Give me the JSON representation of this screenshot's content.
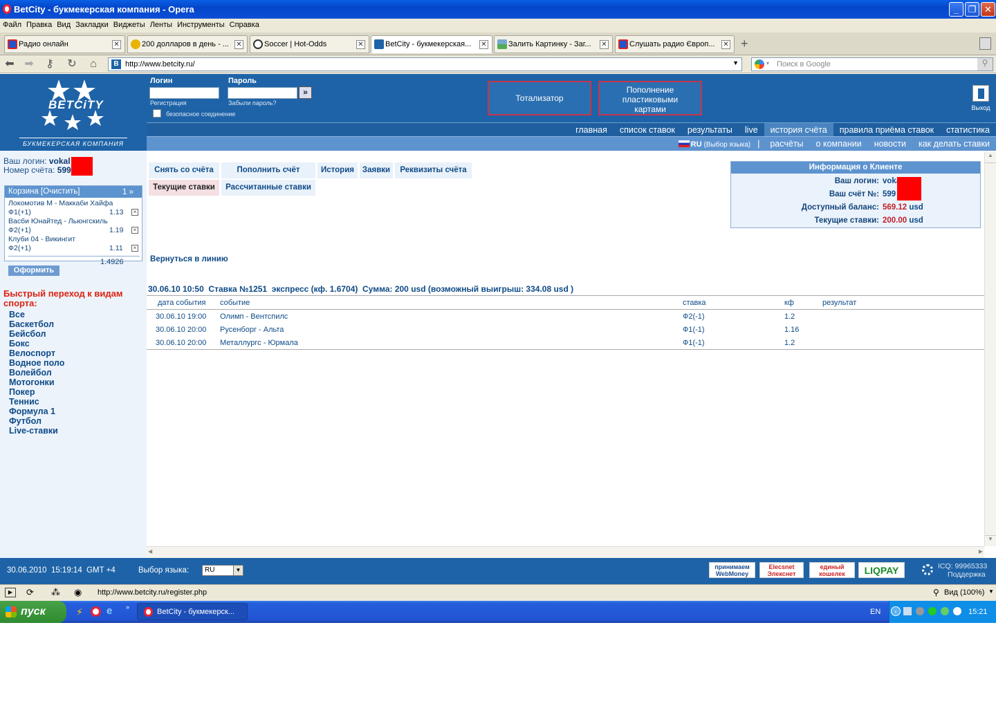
{
  "window": {
    "title": "BetCity - букмекерская компания - Opera"
  },
  "menu": [
    "Файл",
    "Правка",
    "Вид",
    "Закладки",
    "Виджеты",
    "Ленты",
    "Инструменты",
    "Справка"
  ],
  "tabs": [
    {
      "label": "Радио онлайн"
    },
    {
      "label": "200 долларов в день - ..."
    },
    {
      "label": "Soccer | Hot-Odds"
    },
    {
      "label": "BetCity - букмекерская..."
    },
    {
      "label": "Залить Картинку - Заг..."
    },
    {
      "label": "Слушать радио Європ..."
    }
  ],
  "address": {
    "url": "http://www.betcity.ru/",
    "search_placeholder": "Поиск в Google"
  },
  "site": {
    "logo_name": "BETCiTY",
    "logo_sub": "БУКМЕКЕРСКАЯ КОМПАНИЯ",
    "login_label": "Логин",
    "password_label": "Пароль",
    "go_symbol": "»",
    "register": "Регистрация",
    "forgot": "Забыли пароль?",
    "secure": "безопасное соединение",
    "btn_tote": "Тотализатор",
    "btn_topup": "Пополнение пластиковыми картами",
    "exit": "Выход",
    "nav1": [
      "главная",
      "список ставок",
      "результаты",
      "live",
      "история счёта",
      "правила приёма ставок",
      "статистика"
    ],
    "nav2_lang": "RU",
    "nav2_lang_choose": "(Выбор языка)",
    "nav2_sep": "|",
    "nav2": [
      "расчёты",
      "о компании",
      "новости",
      "как делать ставки"
    ]
  },
  "left": {
    "login_label": "Ваш логин:",
    "login_value": "vokal",
    "account_label": "Номер счёта:",
    "account_value": "599",
    "basket_title": "Корзина [Очистить]",
    "basket_count": "1 »",
    "items": [
      {
        "event": "Локомотив М - Маккаби Хайфа",
        "outcome": "Ф1(+1)",
        "coef": "1.13",
        "remove": "×"
      },
      {
        "event": "Васби Юнайтед - Льюнгскиль",
        "outcome": "Ф2(+1)",
        "coef": "1.19",
        "remove": "×"
      },
      {
        "event": "Клуби 04 - Викингит",
        "outcome": "Ф2(+1)",
        "coef": "1.11",
        "remove": "×"
      }
    ],
    "total": "1.4926",
    "order_btn": "Оформить",
    "sports_title": "Быстрый переход к видам спорта:",
    "sports": [
      "Все",
      "Баскетбол",
      "Бейсбол",
      "Бокс",
      "Велоспорт",
      "Водное поло",
      "Волейбол",
      "Мотогонки",
      "Покер",
      "Теннис",
      "Формула 1",
      "Футбол",
      "Live-ставки"
    ]
  },
  "main": {
    "subtabs_row1": [
      "Снять со счёта",
      "Пополнить счёт",
      "История",
      "Заявки",
      "Реквизиты счёта"
    ],
    "subtabs_row2": [
      "Текущие ставки",
      "Рассчитанные ставки"
    ],
    "client": {
      "title": "Информация о Клиенте",
      "login_label": "Ваш логин:",
      "login_value": "vokal",
      "account_label": "Ваш счёт №:",
      "account_value": "599",
      "balance_label": "Доступный баланс:",
      "balance_value": "569.12",
      "balance_cur": "usd",
      "current_label": "Текущие ставки:",
      "current_value": "200.00",
      "current_cur": "usd"
    },
    "back": "Вернуться в линию",
    "bet_header": "30.06.10 10:50  Ставка №1251  экспресс (кф. 1.6704)  Сумма: 200 usd (возможный выигрыш: 334.08 usd )",
    "columns": [
      "дата события",
      "событие",
      "ставка",
      "кф",
      "результат"
    ],
    "rows": [
      {
        "date": "30.06.10 19:00",
        "event": "Олимп - Вентспилс",
        "bet": "Ф2(-1)",
        "coef": "1.2",
        "result": ""
      },
      {
        "date": "30.06.10 20:00",
        "event": "Русенборг - Альта",
        "bet": "Ф1(-1)",
        "coef": "1.16",
        "result": ""
      },
      {
        "date": "30.06.10 20:00",
        "event": "Металлургс - Юрмала",
        "bet": "Ф1(-1)",
        "coef": "1.2",
        "result": ""
      }
    ]
  },
  "footer": {
    "datetime": "30.06.2010  15:19:14  GMT +4",
    "lang_label": "Выбор языка:",
    "lang_value": "RU",
    "pay": [
      "принимаем WebMoney",
      "Elecsnet Элекснет",
      "единый кошелек",
      "LIQPAY"
    ],
    "icq": "ICQ: 99965333",
    "support": "Поддержка"
  },
  "statusbar": {
    "url": "http://www.betcity.ru/register.php",
    "zoom": "Вид (100%)"
  },
  "taskbar": {
    "start": "пуск",
    "item": "BetCity - букмекерск...",
    "lang": "EN",
    "clock": "15:21"
  },
  "colors": {
    "header": "#1e63a7",
    "nav_light": "#5d93cf",
    "left_bg": "#ecf3fb",
    "accent_red": "#c8354a"
  }
}
